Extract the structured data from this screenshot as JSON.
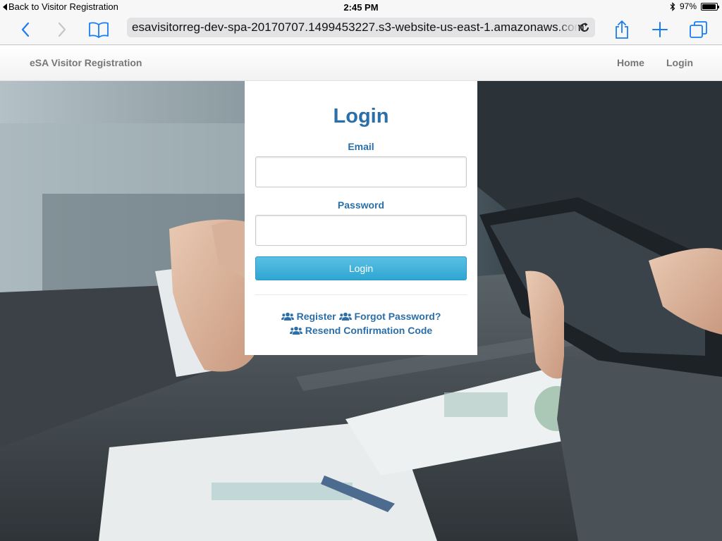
{
  "status_bar": {
    "back_label": "Back to Visitor Registration",
    "time": "2:45 PM",
    "battery_percent": "97%",
    "battery_level": 0.97,
    "bluetooth_icon": "bluetooth-icon"
  },
  "browser": {
    "url": "esavisitorreg-dev-spa-20170707.1499453227.s3-website-us-east-1.amazonaws.com",
    "icons": [
      "back-icon",
      "forward-icon",
      "bookmarks-icon",
      "reload-icon",
      "share-icon",
      "new-tab-icon",
      "tabs-icon"
    ]
  },
  "navbar": {
    "brand": "eSA Visitor Registration",
    "links": [
      "Home",
      "Login"
    ]
  },
  "login": {
    "title": "Login",
    "email_label": "Email",
    "email_value": "",
    "password_label": "Password",
    "password_value": "",
    "button_label": "Login",
    "links": {
      "register": "Register",
      "forgot_password": "Forgot Password?",
      "resend": "Resend Confirmation Code"
    }
  },
  "colors": {
    "accent": "#2a6fa8",
    "button": "#2ea6d3",
    "ios_blue": "#1a7cf5"
  }
}
